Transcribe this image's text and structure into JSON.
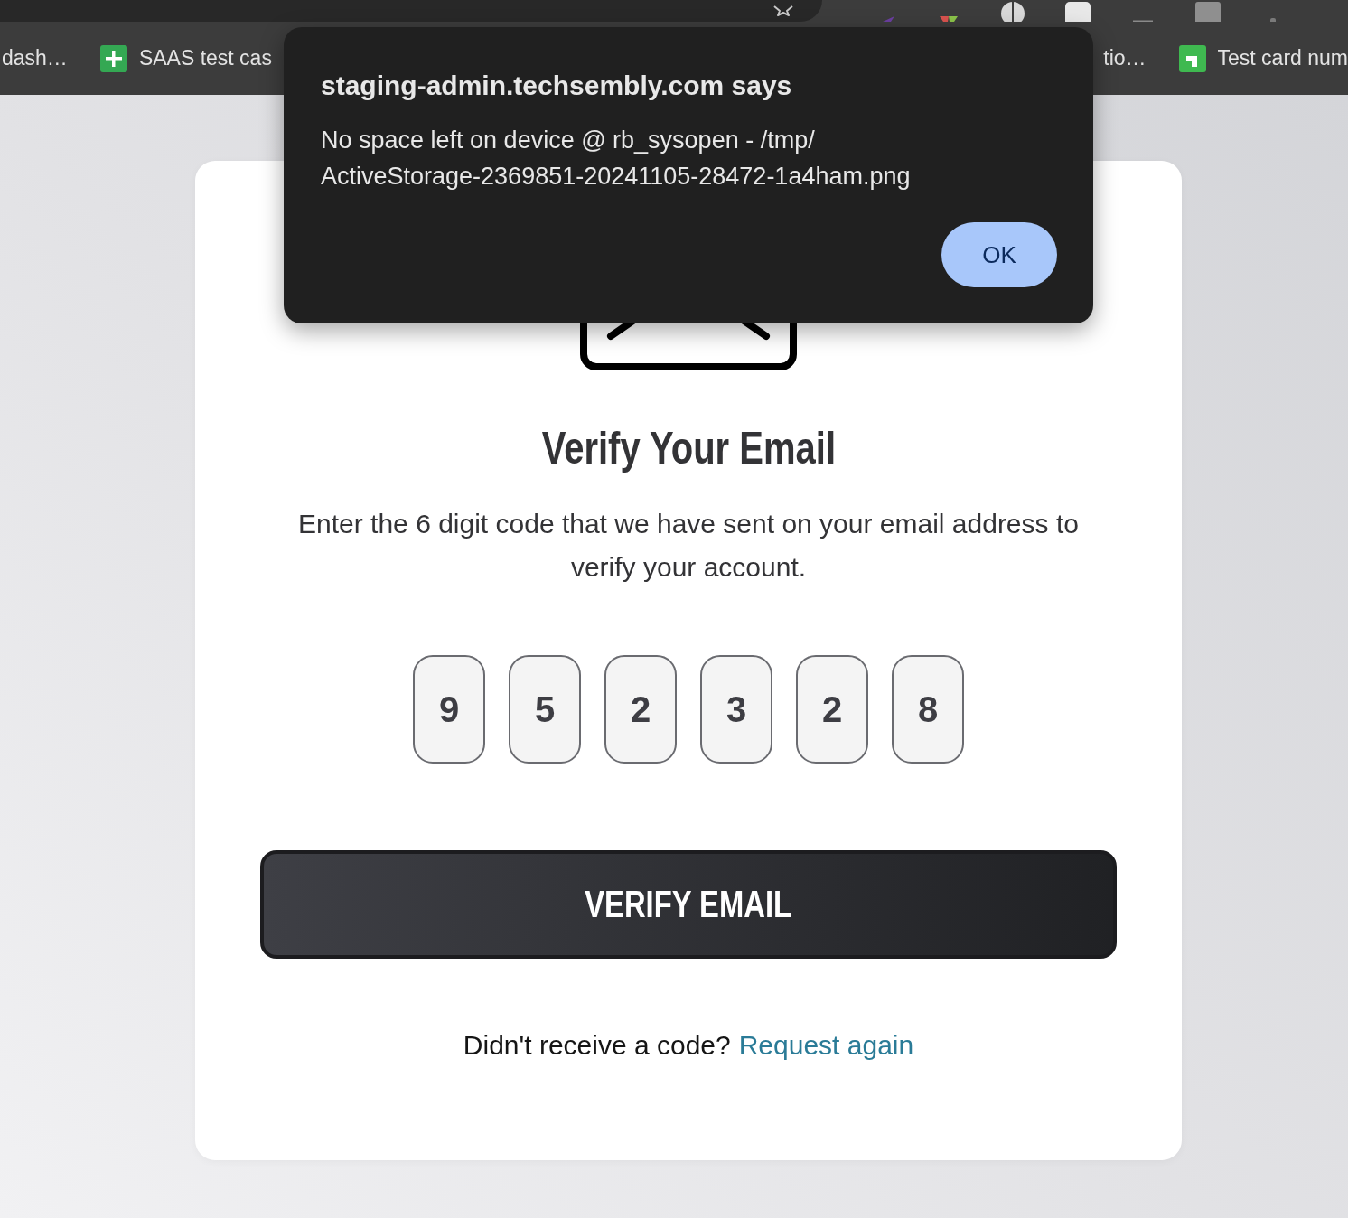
{
  "browser": {
    "bookmarks": [
      {
        "kind": "plain",
        "label": "dash…"
      },
      {
        "kind": "sheet",
        "label": "SAAS test cas"
      },
      {
        "kind": "plain",
        "label": "tio…"
      },
      {
        "kind": "tile",
        "label": "Test card num"
      }
    ]
  },
  "page": {
    "title": "Verify Your Email",
    "description": "Enter the 6 digit code that we have sent on your email address to verify your account.",
    "code": [
      "9",
      "5",
      "2",
      "3",
      "2",
      "8"
    ],
    "button": "VERIFY EMAIL",
    "footer": {
      "text": "Didn't receive a code?",
      "link": "Request again"
    }
  },
  "dialog": {
    "title": "staging-admin.techsembly.com says",
    "message": "No space left on device @ rb_sysopen - /tmp/ActiveStorage-2369851-20241105-28472-1a4ham.png",
    "button": "OK"
  }
}
